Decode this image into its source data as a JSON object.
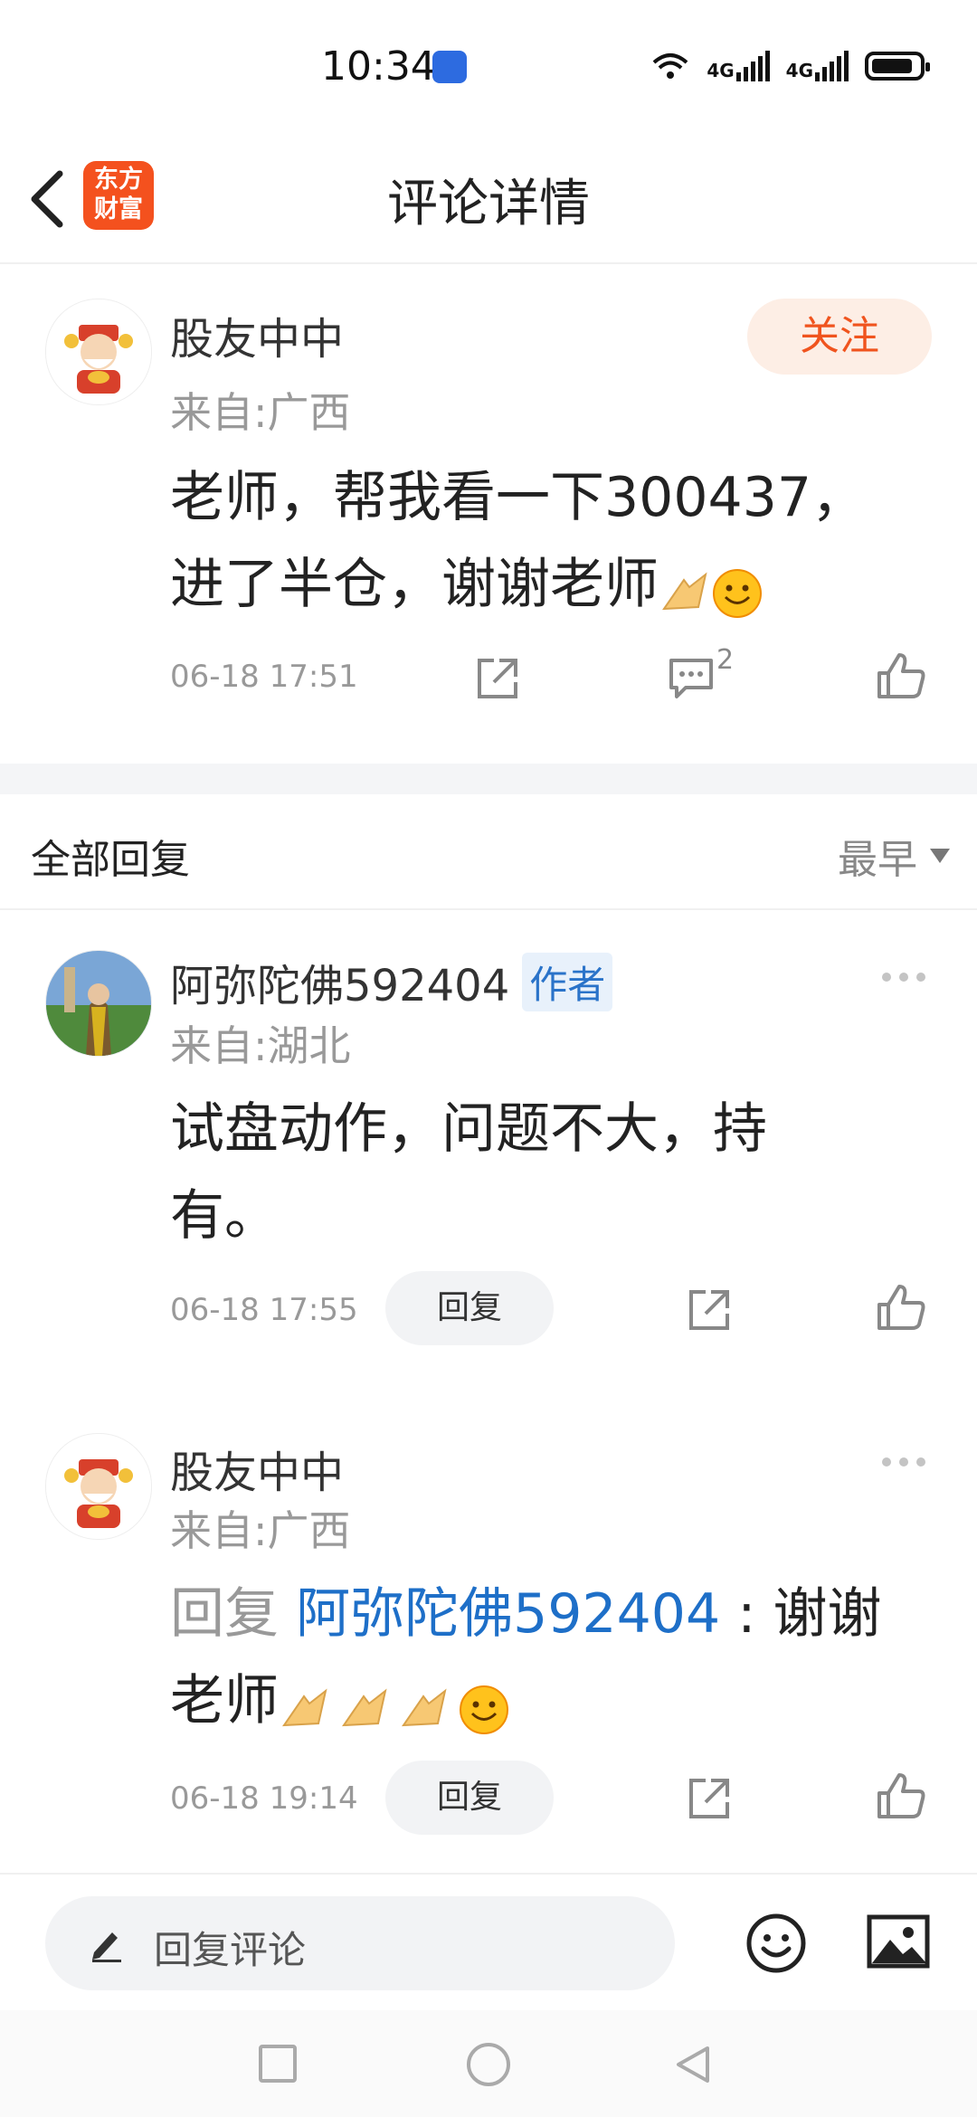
{
  "status_bar": {
    "time": "10:34",
    "net1": "4G",
    "net2": "4G"
  },
  "header": {
    "title": "评论详情",
    "logo_line1": "东方",
    "logo_line2": "财富"
  },
  "post": {
    "username": "股友中中",
    "location": "来自:广西",
    "content_line1": "老师，帮我看一下300437，",
    "content_line2": "进了半仓，谢谢老师",
    "time": "06-18 17:51",
    "comment_count": "2",
    "follow_label": "关注"
  },
  "replies_header": {
    "title": "全部回复",
    "sort": "最早"
  },
  "replies": [
    {
      "username": "阿弥陀佛592404",
      "badge": "作者",
      "location": "来自:湖北",
      "content_line1": "试盘动作，问题不大，持",
      "content_line2": "有。",
      "time": "06-18 17:55",
      "reply_label": "回复"
    },
    {
      "username": "股友中中",
      "location": "来自:广西",
      "reply_prefix": "回复 ",
      "mention": "阿弥陀佛592404",
      "content_line1_suffix": " : 谢谢",
      "content_line2": "老师",
      "time": "06-18 19:14",
      "reply_label": "回复"
    }
  ],
  "input_bar": {
    "placeholder": "回复评论"
  },
  "colors": {
    "accent": "#f0541e",
    "link": "#1e6fc8",
    "badge_bg": "#e8f1fb"
  }
}
